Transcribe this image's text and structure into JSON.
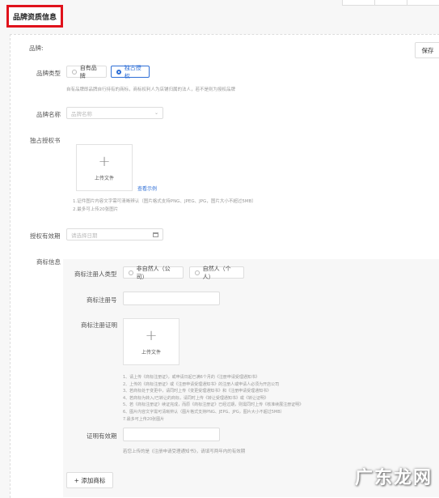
{
  "section_title": "品牌资质信息",
  "save_label": "保存",
  "brand_heading": "品牌:",
  "brand_type": {
    "label": "品牌类型",
    "options": [
      "自有品牌",
      "独占授权"
    ],
    "selected": 1,
    "hint": "自有品牌即品牌自行持有的商标，商标权利人为店铺归属的法人，若不是则为授权品牌"
  },
  "brand_name": {
    "label": "品牌名称",
    "placeholder": "品牌名称"
  },
  "license": {
    "label": "独占授权书",
    "upload_text": "上传文件",
    "example_link": "查看示例",
    "notes": [
      "1.证件图片内容文字需可清晰辨认（图片格式支持PNG、JPEG、JPG，图片大小不超过5MB）",
      "2.最多可上传20张图片"
    ]
  },
  "validity": {
    "label": "授权有效期",
    "placeholder": "请选择日期"
  },
  "trademark": {
    "label": "商标信息",
    "registrant_type_label": "商标注册人类型",
    "registrant_options": [
      "非自然人（公司）",
      "自然人（个人）"
    ],
    "reg_no_label": "商标注册号",
    "cert_label": "商标注册证明",
    "upload_text": "上传文件",
    "notes": [
      "1、请上传《商标注册证》，或申请日起已满6个月的《注册申请受理通知书》",
      "2、上传的《商标注册证》或《注册申请受理通知书》的注册人或申请人必须为开店公司",
      "3、若商标处于变更中，请同时上传《变更受理通知书》和《注册申请受理通知书》",
      "4、若商标为转入/已转让的商标，请同时上传《转让受理通知书》或《转让证明》",
      "5、若《商标注册证》续证完成，而原《商标注册证》已经过期，则需同时上传《核准续展注册证明》",
      "6、图片内容文字需可清晰辨认（图片格式支持PNG、JEPG、JPG，图片大小不超过5MB）",
      "7.最多可上传20张图片"
    ],
    "cert_validity_label": "证明有效期",
    "cert_validity_hint": "若您上传的是《注册申请受理通知书》，请填写两年内的有效期"
  },
  "add_trademark_label": "+ 添加商标",
  "watermark": "广东龙网",
  "colors": {
    "highlight": "#e0121b",
    "accent": "#2f6fd6"
  },
  "icons": {
    "calendar": "calendar-icon",
    "chevron": "chevron-down-icon",
    "plus": "plus-icon"
  }
}
